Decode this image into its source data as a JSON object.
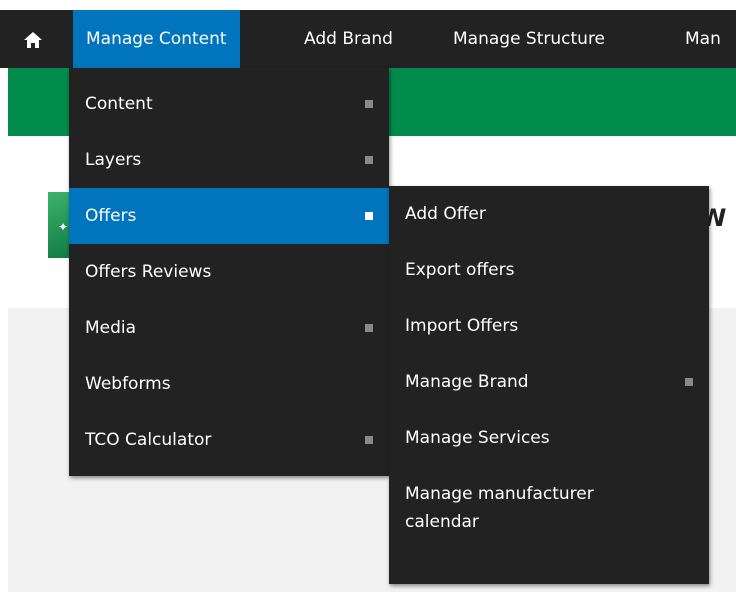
{
  "toolbar": {
    "home_icon": "home-icon",
    "items": [
      {
        "label": "Manage Content",
        "active": true
      },
      {
        "label": "Add Brand"
      },
      {
        "label": "Manage Structure"
      },
      {
        "label": "Man"
      }
    ]
  },
  "page": {
    "welcome_fragment": "W"
  },
  "menu_primary": {
    "items": [
      {
        "label": "Content",
        "has_submenu": true
      },
      {
        "label": "Layers",
        "has_submenu": true
      },
      {
        "label": "Offers",
        "has_submenu": true,
        "active": true
      },
      {
        "label": "Offers Reviews"
      },
      {
        "label": "Media",
        "has_submenu": true
      },
      {
        "label": "Webforms"
      },
      {
        "label": "TCO Calculator",
        "has_submenu": true
      }
    ]
  },
  "menu_offers": {
    "items": [
      {
        "label": "Add Offer"
      },
      {
        "label": "Export offers"
      },
      {
        "label": "Import Offers"
      },
      {
        "label": "Manage Brand",
        "has_submenu": true
      },
      {
        "label": "Manage Services"
      },
      {
        "label": "Manage manufacturer calendar"
      }
    ]
  },
  "colors": {
    "toolbar_bg": "#222222",
    "active_blue": "#0074bd",
    "green_band": "#008b4d",
    "submenu_indicator": "#8a8a8a"
  }
}
